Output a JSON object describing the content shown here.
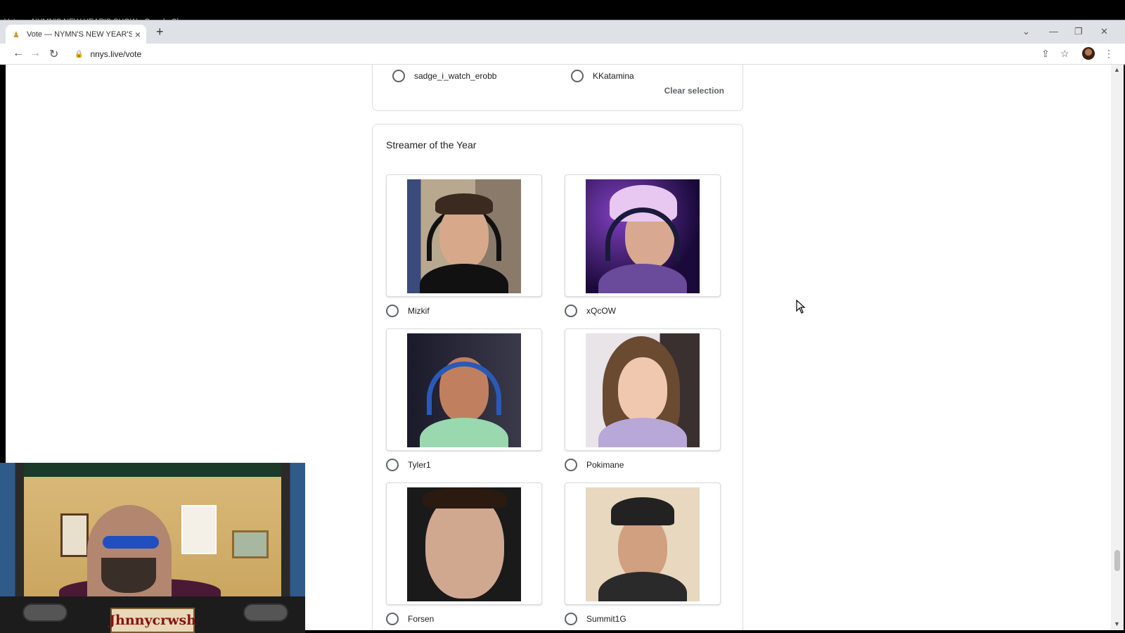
{
  "window": {
    "title": "Vote — NYMN'S NEW YEAR'S SHOW - Google Chrome"
  },
  "tab": {
    "title": "Vote — NYMN'S NEW YEAR'S SH",
    "close": "×",
    "new": "+"
  },
  "toolbar": {
    "url": "nnys.live/vote",
    "back": "←",
    "forward": "→",
    "reload": "↻",
    "lock": "🔒",
    "share": "⇪",
    "star": "☆",
    "menu": "⋮"
  },
  "window_controls": {
    "chevron": "⌄",
    "minimize": "—",
    "restore": "❐",
    "close": "✕"
  },
  "prev_question": {
    "options": [
      {
        "label": "sadge_i_watch_erobb"
      },
      {
        "label": "KKatamina"
      }
    ],
    "clear": "Clear selection"
  },
  "streamer_question": {
    "title": "Streamer of the Year",
    "options": [
      {
        "label": "Mizkif"
      },
      {
        "label": "xQcOW"
      },
      {
        "label": "Tyler1"
      },
      {
        "label": "Pokimane"
      },
      {
        "label": "Forsen"
      },
      {
        "label": "Summit1G"
      }
    ]
  },
  "webcam": {
    "nameplate": "Jhnnycrwsh"
  },
  "colors": {
    "accent": "#5f6368",
    "border": "#dadce0",
    "text": "#202124"
  }
}
